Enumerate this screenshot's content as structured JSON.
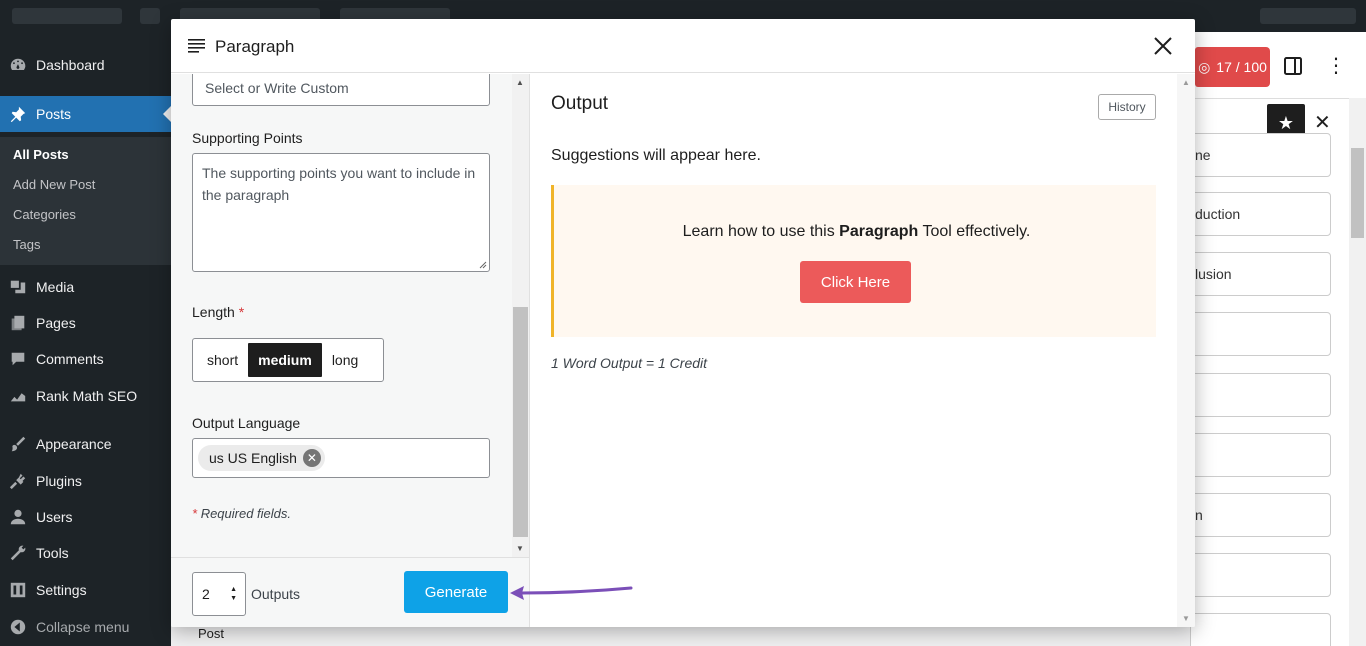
{
  "wp_sidebar": {
    "menu": [
      {
        "label": "Dashboard",
        "icon": "dashboard-icon"
      },
      {
        "label": "Posts",
        "icon": "pushpin-icon",
        "active": true
      },
      {
        "label": "Media",
        "icon": "media-icon"
      },
      {
        "label": "Pages",
        "icon": "pages-icon"
      },
      {
        "label": "Comments",
        "icon": "comments-icon"
      },
      {
        "label": "Rank Math SEO",
        "icon": "rank-math-icon"
      },
      {
        "label": "Appearance",
        "icon": "paintbrush-icon"
      },
      {
        "label": "Plugins",
        "icon": "plugins-icon"
      },
      {
        "label": "Users",
        "icon": "users-icon"
      },
      {
        "label": "Tools",
        "icon": "wrench-icon"
      },
      {
        "label": "Settings",
        "icon": "settings-icon"
      },
      {
        "label": "Collapse menu",
        "icon": "collapse-icon"
      }
    ],
    "submenu": [
      "All Posts",
      "Add New Post",
      "Categories",
      "Tags"
    ]
  },
  "editor": {
    "score_badge": "17 / 100",
    "panel_cards": [
      "ne",
      "duction",
      "lusion",
      "",
      "",
      "",
      "n",
      ""
    ],
    "post_label": "Post"
  },
  "modal": {
    "title": "Paragraph",
    "form": {
      "topic_placeholder": "Select or Write Custom",
      "supporting_points_label": "Supporting Points",
      "supporting_points_placeholder": "The supporting points you want to include in the paragraph",
      "length_label": "Length",
      "required_mark": "*",
      "length_options": [
        "short",
        "medium",
        "long"
      ],
      "length_selected": "medium",
      "output_language_label": "Output Language",
      "output_language_value": "us US English",
      "required_note_mark": "*",
      "required_note": "Required fields."
    },
    "footer": {
      "outputs_count": "2",
      "outputs_label": "Outputs",
      "generate_label": "Generate"
    },
    "output": {
      "title": "Output",
      "history_label": "History",
      "suggestions_text": "Suggestions will appear here.",
      "learn_prefix": "Learn how to use this ",
      "learn_bold": "Paragraph",
      "learn_suffix": " Tool effectively.",
      "click_here_label": "Click Here",
      "credit_note": "1 Word Output = 1 Credit"
    }
  },
  "colors": {
    "generate_button": "#0ea2e7",
    "click_here_button": "#ec5a5a",
    "learn_box_border": "#f0b429",
    "annotation_arrow": "#7b4fb8",
    "wp_active_menu": "#2271b1"
  }
}
